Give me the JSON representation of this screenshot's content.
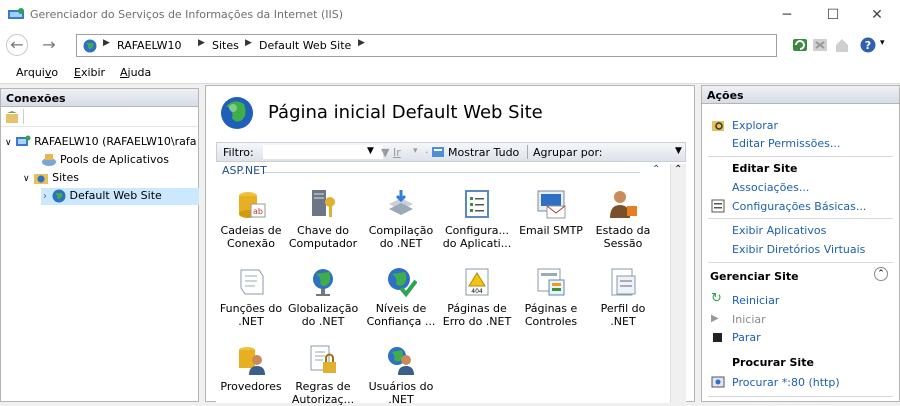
{
  "window": {
    "title": "Gerenciador do Serviços de Informações da Internet (IIS)"
  },
  "breadcrumb": [
    "RAFAELW10",
    "Sites",
    "Default Web Site"
  ],
  "menu": [
    {
      "label": "Arquivo",
      "mnemonic": "v"
    },
    {
      "label": "Exibir",
      "mnemonic": "E"
    },
    {
      "label": "Ajuda",
      "mnemonic": "A"
    }
  ],
  "connections": {
    "title": "Conexões",
    "tree": [
      {
        "label": "RAFAELW10 (RAFAELW10\\rafa",
        "icon": "server-icon"
      },
      {
        "label": "Pools de Aplicativos",
        "icon": "app-pool-icon"
      },
      {
        "label": "Sites",
        "icon": "sites-folder-icon"
      },
      {
        "label": "Default Web Site",
        "icon": "globe-icon"
      }
    ]
  },
  "main": {
    "page_title": "Página inicial Default Web Site",
    "filter_label": "Filtro:",
    "filter_go": "Ir",
    "show_all": "Mostrar Tudo",
    "group_by": "Agrupar por:",
    "group_name": "ASP.NET",
    "features": [
      {
        "label1": "Cadeias de",
        "label2": "Conexão",
        "icon": "connection-strings-icon"
      },
      {
        "label1": "Chave do",
        "label2": "Computador",
        "icon": "machine-key-icon"
      },
      {
        "label1": "Compilação",
        "label2": "do .NET",
        "icon": "net-compilation-icon"
      },
      {
        "label1": "Configura...",
        "label2": "do Aplicati...",
        "icon": "application-settings-icon"
      },
      {
        "label1": "Email SMTP",
        "label2": "",
        "icon": "smtp-email-icon"
      },
      {
        "label1": "Estado da",
        "label2": "Sessão",
        "icon": "session-state-icon"
      },
      {
        "label1": "Funções do",
        "label2": ".NET",
        "icon": "net-roles-icon"
      },
      {
        "label1": "Globalização",
        "label2": "do .NET",
        "icon": "net-globalization-icon"
      },
      {
        "label1": "Níveis de",
        "label2": "Confiança ...",
        "icon": "net-trust-levels-icon"
      },
      {
        "label1": "Páginas de",
        "label2": "Erro do .NET",
        "icon": "net-error-pages-icon"
      },
      {
        "label1": "Páginas e",
        "label2": "Controles",
        "icon": "pages-controls-icon"
      },
      {
        "label1": "Perfil do",
        "label2": ".NET",
        "icon": "net-profile-icon"
      },
      {
        "label1": "Provedores",
        "label2": "",
        "icon": "providers-icon"
      },
      {
        "label1": "Regras de",
        "label2": "Autorizaç...",
        "icon": "authorization-rules-icon"
      },
      {
        "label1": "Usuários do",
        "label2": ".NET",
        "icon": "net-users-icon"
      }
    ]
  },
  "actions": {
    "title": "Ações",
    "explore": "Explorar",
    "edit_permissions": "Editar Permissões...",
    "edit_site": "Editar Site",
    "bindings": "Associações...",
    "basic_settings": "Configurações Básicas...",
    "view_apps": "Exibir Aplicativos",
    "view_vdirs": "Exibir Diretórios Virtuais",
    "manage_site": "Gerenciar Site",
    "restart": "Reiniciar",
    "start": "Iniciar",
    "stop": "Parar",
    "browse_site": "Procurar Site",
    "browse_80": "Procurar *:80 (http)"
  },
  "colors": {
    "link": "#1c5fb0",
    "selection": "#cce8ff",
    "header": "#d7dde6"
  }
}
